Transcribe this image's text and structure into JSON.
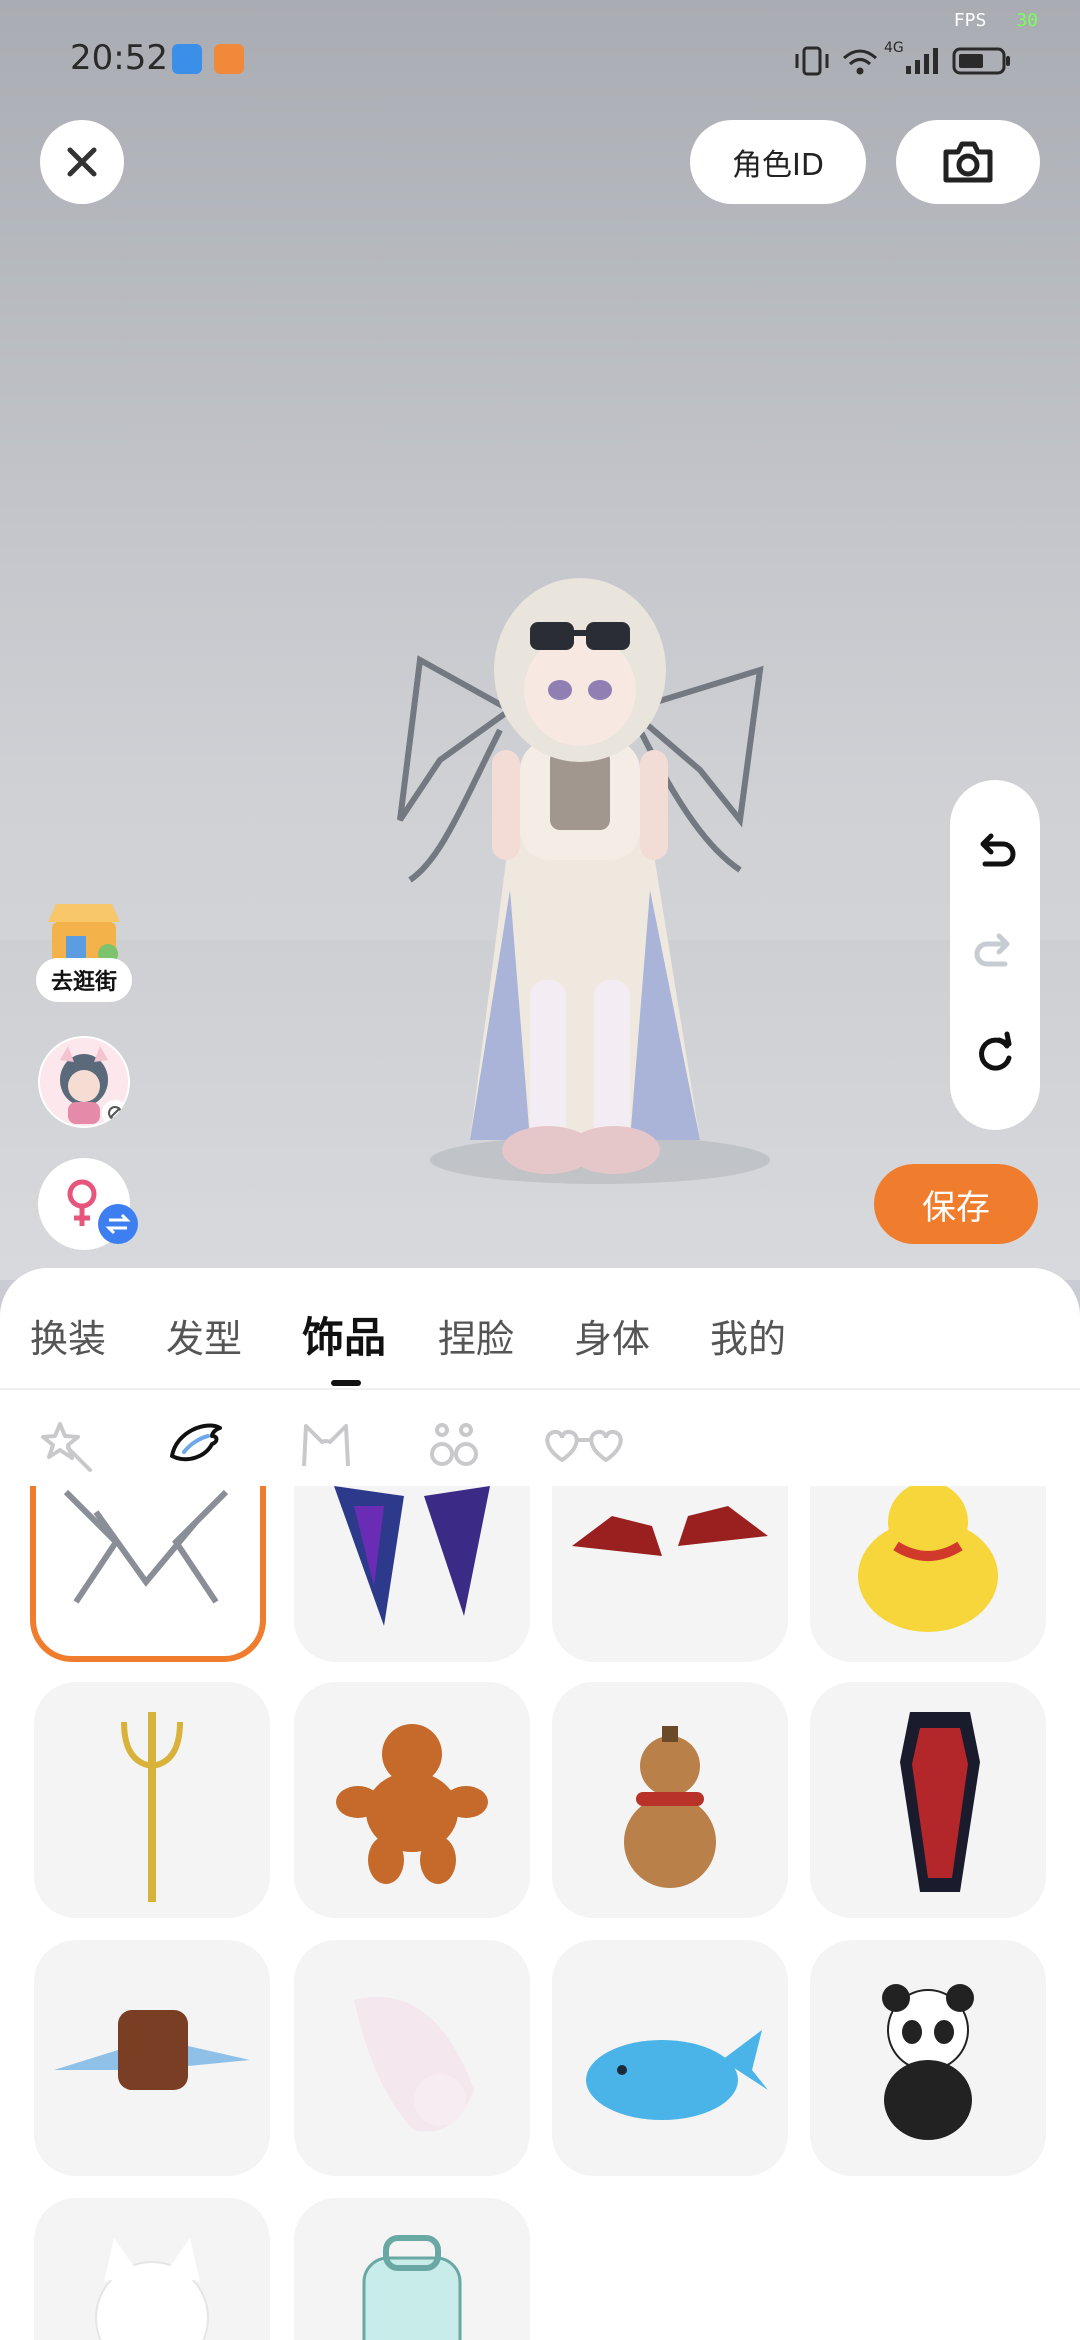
{
  "status_bar": {
    "time": "20:52",
    "fps_label": "FPS",
    "fps_value": "30",
    "network": "4G"
  },
  "top_bar": {
    "role_id_label": "角色ID",
    "close_icon": "close-icon",
    "camera_icon": "camera-icon"
  },
  "left_actions": {
    "shop_label": "去逛街"
  },
  "tools": {
    "undo_icon": "undo-icon",
    "redo_icon": "redo-icon",
    "reset_icon": "reset-icon"
  },
  "save_label": "保存",
  "tabs": [
    {
      "label": "换装"
    },
    {
      "label": "发型"
    },
    {
      "label": "饰品",
      "active": true
    },
    {
      "label": "捏脸"
    },
    {
      "label": "身体"
    },
    {
      "label": "我的"
    }
  ],
  "categories": [
    {
      "icon": "magic-wand-icon"
    },
    {
      "icon": "wing-icon",
      "active": true
    },
    {
      "icon": "ears-icon"
    },
    {
      "icon": "earrings-icon"
    },
    {
      "icon": "heart-glasses-icon"
    }
  ],
  "items": [
    {
      "name": "chain-wings",
      "selected": true
    },
    {
      "name": "dark-wings"
    },
    {
      "name": "bat-wings"
    },
    {
      "name": "duck"
    },
    {
      "name": "trident"
    },
    {
      "name": "gingerbread-man"
    },
    {
      "name": "gourd"
    },
    {
      "name": "coffin"
    },
    {
      "name": "jet-backpack"
    },
    {
      "name": "ghost-cat"
    },
    {
      "name": "whale"
    },
    {
      "name": "panda"
    },
    {
      "name": "white-cat"
    },
    {
      "name": "backpack"
    }
  ],
  "colors": {
    "accent": "#f07d2e",
    "save_bg": "#f07d2e"
  }
}
